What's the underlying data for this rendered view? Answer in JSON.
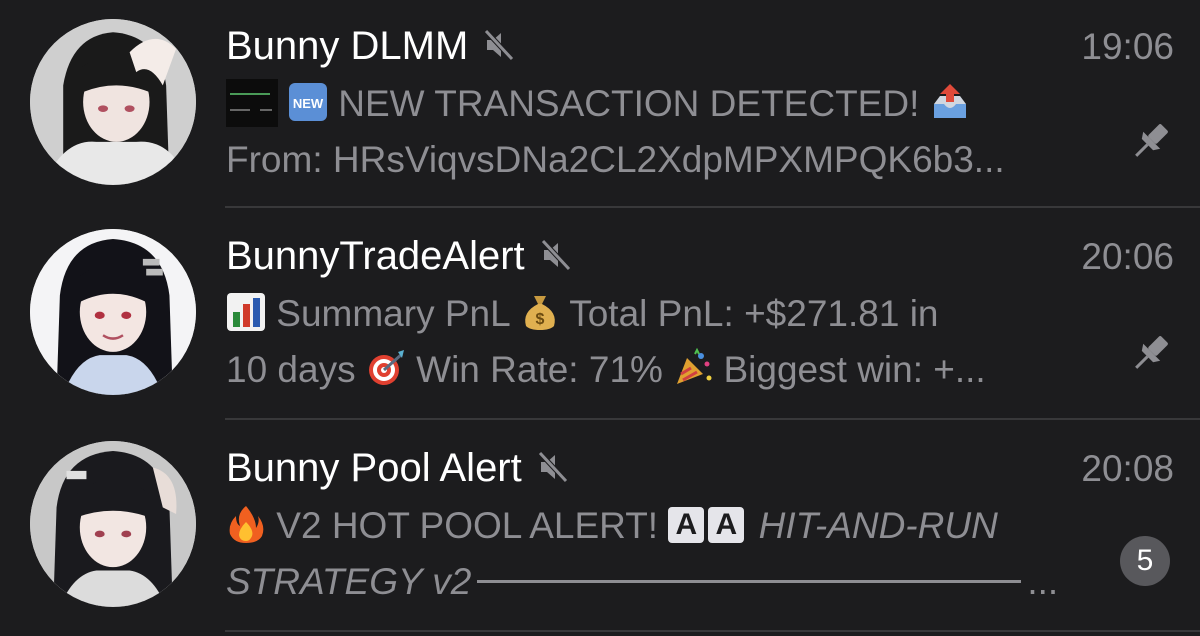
{
  "chats": [
    {
      "name": "Bunny DLMM",
      "time": "19:06",
      "muted": true,
      "pinned": true,
      "preview_line1": {
        "badge_emoji": "new-button-emoji",
        "text": "NEW TRANSACTION DETECTED!",
        "trailing_emoji": "outbox-tray-emoji"
      },
      "preview_line2": "From: HRsViqvsDNa2CL2XdpMPXMPQK6b3..."
    },
    {
      "name": "BunnyTradeAlert",
      "time": "20:06",
      "muted": true,
      "pinned": true,
      "preview_line1": {
        "emoji1": "bar-chart-emoji",
        "text1": "Summary PnL",
        "emoji2": "money-bag-emoji",
        "text2": "Total PnL: +$271.81 in"
      },
      "preview_line2": {
        "text1": "10 days",
        "emoji1": "direct-hit-emoji",
        "text2": "Win Rate: 71%",
        "emoji2": "party-popper-emoji",
        "text3": "Biggest win: +..."
      }
    },
    {
      "name": "Bunny Pool Alert",
      "time": "20:08",
      "muted": true,
      "unread_count": "5",
      "preview_line1": {
        "emoji1": "fire-emoji",
        "text": "V2 HOT POOL ALERT!",
        "box1": "A",
        "box2": "A",
        "italic_text": "HIT-AND-RUN"
      },
      "preview_line2": {
        "italic_text": "STRATEGY v2",
        "ellipsis": "..."
      }
    }
  ],
  "colors": {
    "background": "#1c1c1e",
    "title": "#ffffff",
    "secondary": "#8e8e93",
    "separator": "#38383a",
    "badge": "#58585c"
  }
}
